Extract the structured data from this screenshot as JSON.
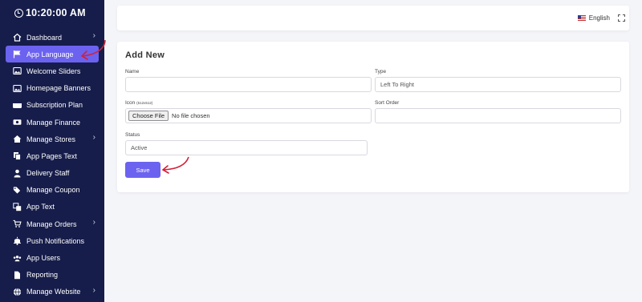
{
  "clock": {
    "time": "10:20:00 AM"
  },
  "sidebar": {
    "items": [
      {
        "label": "Dashboard",
        "icon": "home-icon",
        "has_submenu": true
      },
      {
        "label": "App Language",
        "icon": "flag-icon",
        "active": true
      },
      {
        "label": "Welcome Sliders",
        "icon": "image-icon"
      },
      {
        "label": "Homepage Banners",
        "icon": "image-icon"
      },
      {
        "label": "Subscription Plan",
        "icon": "credit-card-icon"
      },
      {
        "label": "Manage Finance",
        "icon": "money-icon"
      },
      {
        "label": "Manage Stores",
        "icon": "store-icon",
        "has_submenu": true
      },
      {
        "label": "App Pages Text",
        "icon": "copy-icon"
      },
      {
        "label": "Delivery Staff",
        "icon": "user-icon"
      },
      {
        "label": "Manage Coupon",
        "icon": "tags-icon"
      },
      {
        "label": "App Text",
        "icon": "language-icon"
      },
      {
        "label": "Manage Orders",
        "icon": "cart-icon",
        "has_submenu": true
      },
      {
        "label": "Push Notifications",
        "icon": "bell-icon"
      },
      {
        "label": "App Users",
        "icon": "users-icon"
      },
      {
        "label": "Reporting",
        "icon": "file-icon"
      },
      {
        "label": "Manage Website",
        "icon": "globe-icon",
        "has_submenu": true
      }
    ]
  },
  "topbar": {
    "language": "English",
    "flag_icon": "us-flag-icon",
    "fullscreen_icon": "expand-icon"
  },
  "form": {
    "title": "Add New",
    "name": {
      "label": "Name",
      "value": ""
    },
    "type": {
      "label": "Type",
      "value": "Left To Right"
    },
    "icon": {
      "label": "Icon",
      "hint": "(512x512)",
      "button": "Choose File",
      "status": "No file chosen"
    },
    "sort_order": {
      "label": "Sort Order",
      "value": ""
    },
    "status": {
      "label": "Status",
      "value": "Active"
    },
    "save_label": "Save"
  },
  "colors": {
    "sidebar_bg": "#161d4a",
    "accent": "#6c62f0",
    "annotation": "#d0223a"
  }
}
